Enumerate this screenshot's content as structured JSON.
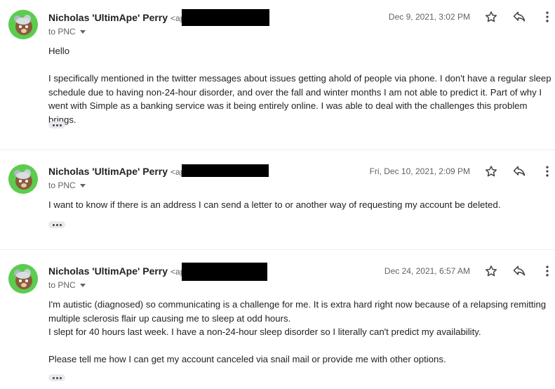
{
  "messages": [
    {
      "sender": "Nicholas 'UltimApe' Perry",
      "email_prefix": "<ape",
      "to": "to PNC",
      "date": "Dec 9, 2021, 3:02 PM",
      "body": [
        "Hello",
        "I specifically mentioned in the twitter messages about issues getting ahold of people via phone. I don't have a regular sleep schedule due to having non-24-hour disorder, and over the fall and winter months I am not able to predict it. Part of why I went with Simple as a banking service was it being entirely online. I was able to deal with the challenges this problem brings."
      ]
    },
    {
      "sender": "Nicholas 'UltimApe' Perry",
      "email_prefix": "<ape",
      "to": "to PNC",
      "date": "Fri, Dec 10, 2021, 2:09 PM",
      "body": [
        "I want to know if there is an address I can send a letter to or another way of requesting my account be deleted."
      ]
    },
    {
      "sender": "Nicholas 'UltimApe' Perry",
      "email_prefix": "<ape",
      "to": "to PNC",
      "date": "Dec 24, 2021, 6:57 AM",
      "body": [
        "I'm autistic (diagnosed) so communicating is a challenge for me. It is extra hard right now because of a relapsing remitting multiple sclerosis flair up causing me to sleep at odd hours.",
        "I slept for 40 hours last week. I have a non-24-hour sleep disorder so I literally can't predict my availability.",
        "Please tell me how I can get my account canceled via snail mail or provide me with other options."
      ]
    }
  ],
  "icons": [
    "star-icon",
    "reply-icon",
    "more-vert-icon",
    "avatar-bear-icon",
    "show-trimmed-content-icon"
  ],
  "colors": {
    "avatar_bg": "#5ccc4f",
    "redaction": "#000000",
    "secondary_text": "#5f6368"
  }
}
